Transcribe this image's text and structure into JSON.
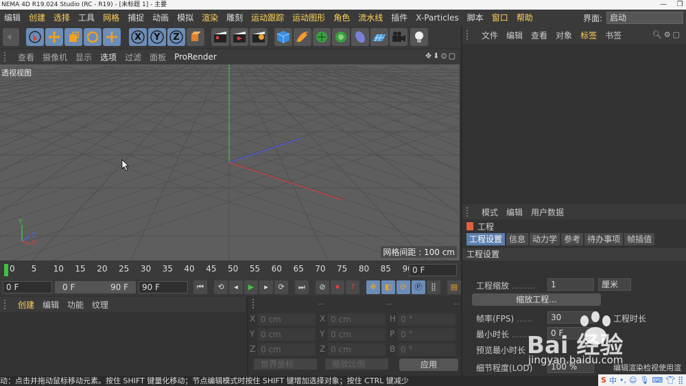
{
  "window": {
    "title": "NEMA 4D R19.024 Studio (RC - R19) - [未标题 1] - 主要"
  },
  "menubar": {
    "items": [
      {
        "label": "编辑",
        "hl": false
      },
      {
        "label": "创建",
        "hl": true
      },
      {
        "label": "选择",
        "hl": true
      },
      {
        "label": "工具",
        "hl": false
      },
      {
        "label": "网格",
        "hl": true
      },
      {
        "label": "捕捉",
        "hl": false
      },
      {
        "label": "动画",
        "hl": false
      },
      {
        "label": "模拟",
        "hl": false
      },
      {
        "label": "渲染",
        "hl": true
      },
      {
        "label": "雕刻",
        "hl": false
      },
      {
        "label": "运动跟踪",
        "hl": true
      },
      {
        "label": "运动图形",
        "hl": true
      },
      {
        "label": "角色",
        "hl": true
      },
      {
        "label": "流水线",
        "hl": true
      },
      {
        "label": "插件",
        "hl": false
      },
      {
        "label": "X-Particles",
        "hl": false
      },
      {
        "label": "脚本",
        "hl": false
      },
      {
        "label": "窗口",
        "hl": true
      },
      {
        "label": "帮助",
        "hl": true
      }
    ],
    "interface_label": "界面:",
    "interface_value": "启动"
  },
  "toolbar": {
    "axis_x": "X",
    "axis_y": "Y",
    "axis_z": "Z"
  },
  "viewport_menu": {
    "items": [
      "查看",
      "摄像机",
      "显示",
      "选项",
      "过滤",
      "面板",
      "ProRender"
    ],
    "active": "选项",
    "controls": "✥⬇⊙▢"
  },
  "viewport": {
    "label": "透视视图",
    "grid_spacing": "网格间距 : 100 cm",
    "axis_x": "X",
    "axis_y": "Y",
    "axis_z": "Z"
  },
  "objects_panel": {
    "menu": [
      "文件",
      "编辑",
      "查看",
      "对象",
      "标签",
      "书签"
    ],
    "highlight": "标签"
  },
  "attributes_panel": {
    "menu": [
      "模式",
      "编辑",
      "用户数据"
    ],
    "object_title": "工程",
    "tabs": [
      "工程设置",
      "信息",
      "动力学",
      "参考",
      "待办事项",
      "帧插值"
    ],
    "active_tab": "工程设置",
    "section": "工程设置",
    "scale_label": "工程缩放",
    "scale_value": "1",
    "scale_unit": "厘米",
    "scale_button": "缩放工程...",
    "fps_label": "帧率(FPS)",
    "fps_value": "30",
    "project_length_label": "工程时长",
    "min_time_label": "最小时长",
    "min_time_value": "0 F",
    "preview_min_label": "预览最小时长",
    "lod_label": "细节程度(LOD)",
    "lod_value": "100 %",
    "lod_right": "编辑渲染检视使用渲"
  },
  "timeline": {
    "ticks": [
      "0",
      "5",
      "10",
      "15",
      "20",
      "25",
      "30",
      "35",
      "40",
      "45",
      "50",
      "55",
      "60",
      "65",
      "70",
      "75",
      "80",
      "85",
      "90"
    ],
    "current_frame": "0 F"
  },
  "transport": {
    "start": "0 F",
    "range_start": "0 F",
    "range_end": "90 F",
    "end": "90 F"
  },
  "material_panel": {
    "menu": [
      "创建",
      "编辑",
      "功能",
      "纹理"
    ],
    "highlight": "创建"
  },
  "coord_panel": {
    "head": [
      "--",
      "--",
      "--"
    ],
    "rows": [
      {
        "l1": "X",
        "v1": "0 cm",
        "l2": "X",
        "v2": "0 cm",
        "l3": "H",
        "v3": "0 °"
      },
      {
        "l1": "Y",
        "v1": "0 cm",
        "l2": "Y",
        "v2": "0 cm",
        "l3": "P",
        "v3": "0 °"
      },
      {
        "l1": "Z",
        "v1": "0 cm",
        "l2": "Z",
        "v2": "0 cm",
        "l3": "B",
        "v3": "0 °"
      }
    ],
    "world": "世界坐标",
    "scale": "缩放比例",
    "apply": "应用"
  },
  "status": "动：点击并拖动鼠标移动元素。按住 SHIFT 键量化移动；节点编辑模式时按住 SHIFT 键增加选择对象；按住 CTRL 键减少",
  "watermark": {
    "brand": "Bai 经验",
    "url": "jingyan.baidu.com"
  },
  "ime": {
    "label": "中"
  }
}
